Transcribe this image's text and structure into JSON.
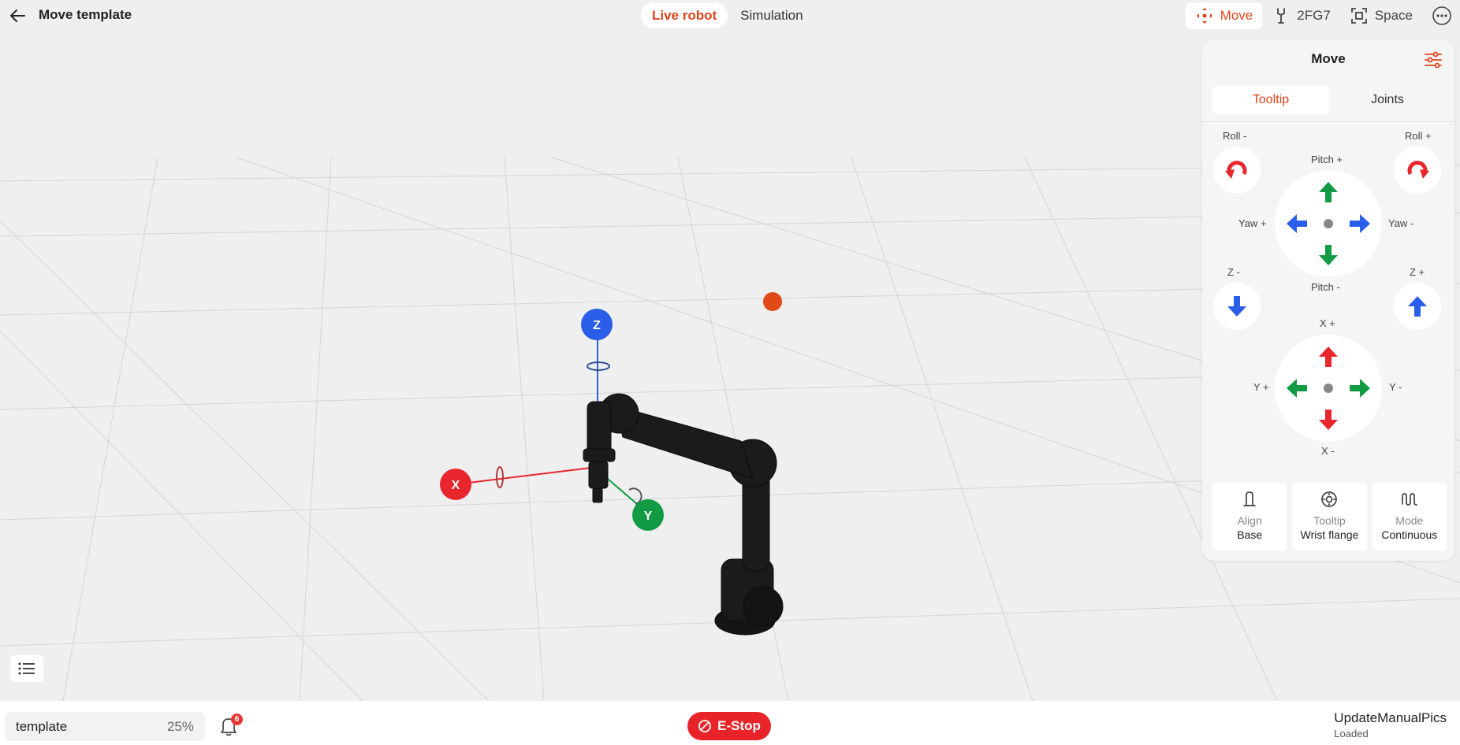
{
  "header": {
    "title": "Move template",
    "modes": [
      "Live robot",
      "Simulation"
    ],
    "active_mode": "Live robot",
    "right_buttons": {
      "move": "Move",
      "gripper": "2FG7",
      "space": "Space"
    }
  },
  "viewport": {
    "axes": {
      "x": "X",
      "y": "Y",
      "z": "Z"
    }
  },
  "move_panel": {
    "title": "Move",
    "tabs": [
      "Tooltip",
      "Joints"
    ],
    "active_tab": "Tooltip",
    "orientation": {
      "roll_minus": "Roll -",
      "roll_plus": "Roll +",
      "pitch_plus": "Pitch +",
      "pitch_minus": "Pitch -",
      "yaw_plus": "Yaw +",
      "yaw_minus": "Yaw -"
    },
    "translation": {
      "z_minus": "Z -",
      "z_plus": "Z +",
      "x_plus": "X +",
      "x_minus": "X -",
      "y_plus": "Y +",
      "y_minus": "Y -"
    },
    "options": [
      {
        "key": "Align",
        "value": "Base",
        "icon": "base-icon"
      },
      {
        "key": "Tooltip",
        "value": "Wrist flange",
        "icon": "flange-icon"
      },
      {
        "key": "Mode",
        "value": "Continuous",
        "icon": "wave-icon"
      }
    ]
  },
  "footer": {
    "program_name": "template",
    "speed": "25%",
    "notification_count": "6",
    "estop_label": "E-Stop",
    "status_title": "UpdateManualPics",
    "status_sub": "Loaded"
  },
  "colors": {
    "accent": "#e3431b",
    "x_axis": "#e8262d",
    "y_axis": "#129a44",
    "z_axis": "#2a5ee8",
    "estop": "#e8242a"
  }
}
